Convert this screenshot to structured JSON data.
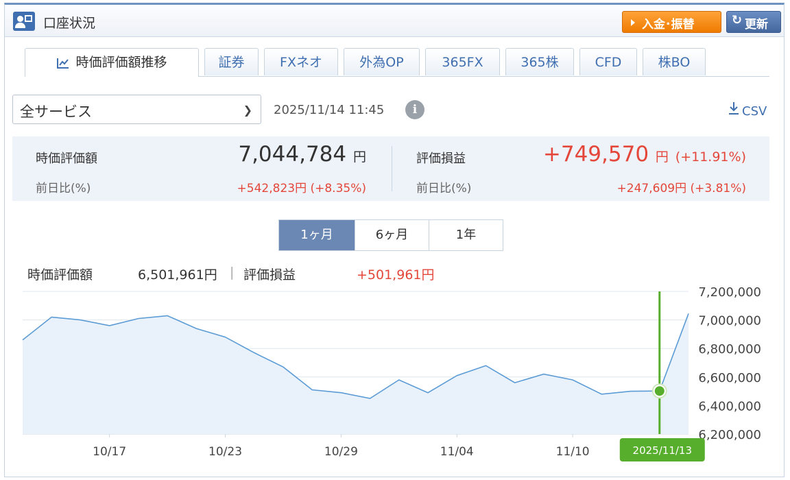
{
  "header": {
    "title": "口座状況",
    "deposit_button": "入金･振替",
    "refresh_button": "更新"
  },
  "tabs": [
    {
      "label": "時価評価額推移",
      "active": true
    },
    {
      "label": "証券",
      "active": false
    },
    {
      "label": "FXネオ",
      "active": false
    },
    {
      "label": "外為OP",
      "active": false
    },
    {
      "label": "365FX",
      "active": false
    },
    {
      "label": "365株",
      "active": false
    },
    {
      "label": "CFD",
      "active": false
    },
    {
      "label": "株BO",
      "active": false
    }
  ],
  "filter": {
    "service_select": "全サービス",
    "timestamp": "2025/11/14 11:45",
    "csv_label": "CSV"
  },
  "summary": {
    "market_value_label": "時価評価額",
    "market_value": "7,044,784",
    "unit": "円",
    "market_value_change_label": "前日比(%)",
    "market_value_change": "+542,823円 (+8.35%)",
    "pl_label": "評価損益",
    "pl_value": "+749,570",
    "pl_percent": "(+11.91%)",
    "pl_change_label": "前日比(%)",
    "pl_change": "+247,609円 (+3.81%)"
  },
  "period": {
    "options": [
      "1ヶ月",
      "6ヶ月",
      "1年"
    ],
    "selected": "1ヶ月"
  },
  "readout": {
    "value_label": "時価評価額",
    "value": "6,501,961円",
    "separator": "|",
    "pl_label": "評価損益",
    "pl": "+501,961円"
  },
  "colors": {
    "accent": "#3f6fb0",
    "line": "#5b9bd5",
    "fill": "#e9f2fb",
    "positive": "#e4463a",
    "cursor": "#57ad2c"
  },
  "chart_data": {
    "type": "area",
    "x": [
      "2025/10/14",
      "2025/10/15",
      "2025/10/16",
      "2025/10/17",
      "2025/10/20",
      "2025/10/21",
      "2025/10/22",
      "2025/10/23",
      "2025/10/24",
      "2025/10/27",
      "2025/10/28",
      "2025/10/29",
      "2025/10/30",
      "2025/10/31",
      "2025/11/03",
      "2025/11/04",
      "2025/11/05",
      "2025/11/06",
      "2025/11/07",
      "2025/11/10",
      "2025/11/11",
      "2025/11/12",
      "2025/11/13",
      "2025/11/14"
    ],
    "values": [
      6860000,
      7020000,
      7000000,
      6960000,
      7010000,
      7030000,
      6940000,
      6880000,
      6770000,
      6670000,
      6510000,
      6490000,
      6450000,
      6580000,
      6490000,
      6610000,
      6680000,
      6560000,
      6620000,
      6580000,
      6480000,
      6500000,
      6501961,
      7044784
    ],
    "x_tick_labels": [
      "10/17",
      "10/23",
      "10/29",
      "11/04",
      "11/10"
    ],
    "x_tick_positions": [
      3,
      7,
      11,
      15,
      19
    ],
    "y_ticks": [
      6200000,
      6400000,
      6600000,
      6800000,
      7000000,
      7200000
    ],
    "y_tick_labels": [
      "6,200,000",
      "6,400,000",
      "6,600,000",
      "6,800,000",
      "7,000,000",
      "7,200,000"
    ],
    "ylim": [
      6200000,
      7200000
    ],
    "grid": true,
    "selected_index": 22,
    "selected_label": "2025/11/13"
  }
}
